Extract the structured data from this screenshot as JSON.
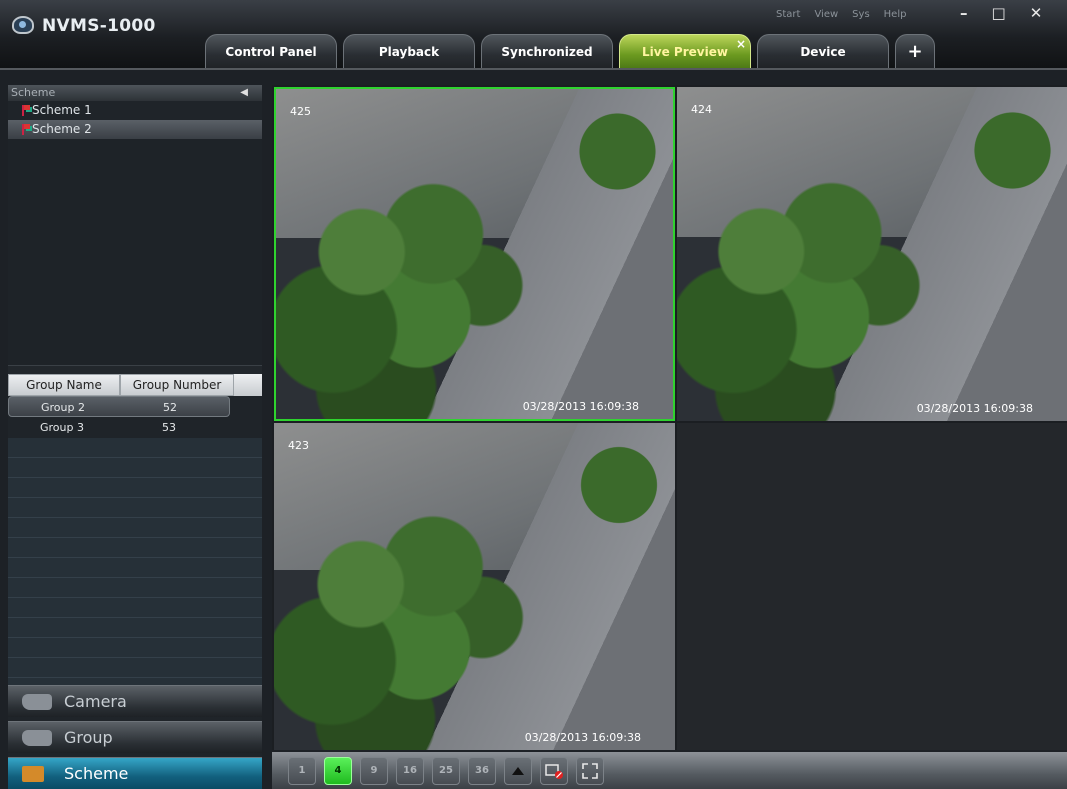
{
  "app": {
    "title": "NVMS-1000",
    "menu": [
      "Start",
      "View",
      "Sys",
      "Help"
    ],
    "window_controls": [
      "–",
      "□",
      "✕"
    ]
  },
  "tabs": [
    {
      "label": "Control Panel",
      "active": false
    },
    {
      "label": "Playback",
      "active": false
    },
    {
      "label": "Synchronized",
      "active": false
    },
    {
      "label": "Live Preview",
      "active": true,
      "close": "×"
    },
    {
      "label": "Device",
      "active": false
    },
    {
      "label": "+",
      "active": false
    }
  ],
  "scheme": {
    "header": "Scheme",
    "collapse": "◀",
    "items": [
      {
        "label": "Scheme 1",
        "selected": false
      },
      {
        "label": "Scheme 2",
        "selected": true
      }
    ]
  },
  "groups": {
    "columns": [
      "Group Name",
      "Group Number"
    ],
    "rows": [
      {
        "name": "Group 2",
        "number": "52",
        "selected": true
      },
      {
        "name": "Group 3",
        "number": "53",
        "selected": false
      }
    ]
  },
  "nav": {
    "camera": "Camera",
    "group": "Group",
    "scheme": "Scheme"
  },
  "video": {
    "cells": [
      {
        "channel": "425",
        "timestamp": "03/28/2013  16:09:38",
        "selected": true
      },
      {
        "channel": "424",
        "timestamp": "03/28/2013  16:09:38",
        "selected": false
      },
      {
        "channel": "423",
        "timestamp": "03/28/2013  16:09:38",
        "selected": false
      },
      {
        "channel": "",
        "timestamp": "",
        "selected": false
      }
    ]
  },
  "toolbar": {
    "layouts": [
      "1",
      "4",
      "9",
      "16",
      "25",
      "36"
    ],
    "active_layout": "4"
  },
  "colors": {
    "accent_tab": "#8fbf2a",
    "selected_cell_border": "#2fd32f",
    "active_nav": "#1a84a8"
  }
}
